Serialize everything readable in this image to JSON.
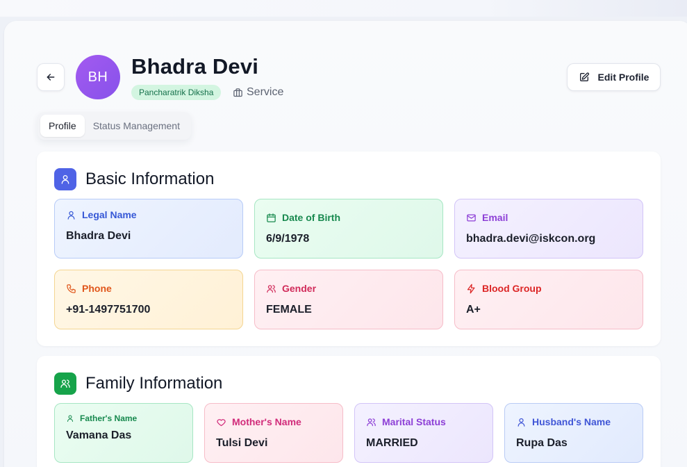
{
  "profile": {
    "initials": "BH",
    "name": "Bhadra Devi",
    "badge": "Pancharatrik Diksha",
    "department": "Service",
    "edit_label": "Edit Profile"
  },
  "tabs": [
    {
      "label": "Profile",
      "active": true
    },
    {
      "label": "Status Management",
      "active": false
    }
  ],
  "basic": {
    "title": "Basic Information",
    "fields": [
      {
        "label": "Legal Name",
        "value": "Bhadra Devi",
        "icon": "user-icon"
      },
      {
        "label": "Date of Birth",
        "value": "6/9/1978",
        "icon": "calendar-icon"
      },
      {
        "label": "Email",
        "value": "bhadra.devi@iskcon.org",
        "icon": "mail-icon"
      },
      {
        "label": "Phone",
        "value": "+91-1497751700",
        "icon": "phone-icon"
      },
      {
        "label": "Gender",
        "value": "FEMALE",
        "icon": "users-icon"
      },
      {
        "label": "Blood Group",
        "value": "A+",
        "icon": "bolt-icon"
      }
    ]
  },
  "family": {
    "title": "Family Information",
    "fields": [
      {
        "label": "Father's Name",
        "value": "Vamana Das",
        "icon": "user-icon"
      },
      {
        "label": "Mother's Name",
        "value": "Tulsi Devi",
        "icon": "heart-icon"
      },
      {
        "label": "Marital Status",
        "value": "MARRIED",
        "icon": "users-icon"
      },
      {
        "label": "Husband's Name",
        "value": "Rupa Das",
        "icon": "user-icon"
      }
    ]
  },
  "colors": {
    "basic_accent": "#4f63e6",
    "family_accent": "#16a34a",
    "avatar": "#9657ee",
    "badge_bg": "#d3f5e1"
  }
}
